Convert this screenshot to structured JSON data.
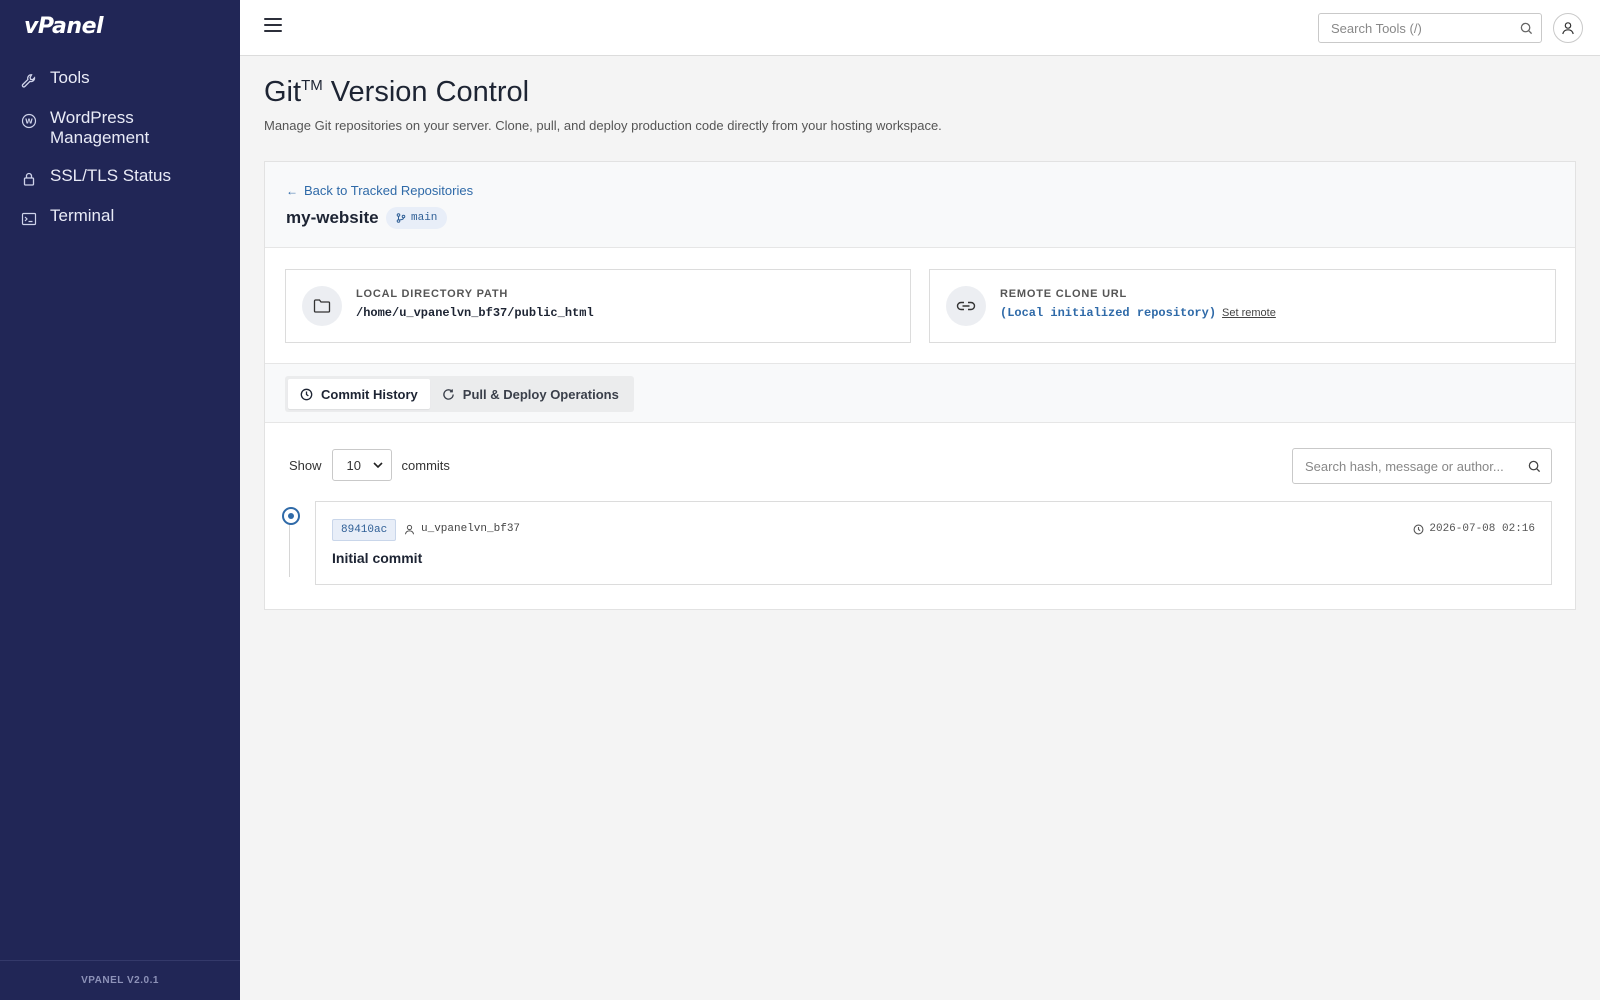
{
  "app": {
    "logo": "vPanel",
    "version": "VPANEL V2.0.1"
  },
  "sidebar": {
    "items": [
      {
        "label": "Tools",
        "icon": "wrench-icon"
      },
      {
        "label": "WordPress Management",
        "icon": "wordpress-icon"
      },
      {
        "label": "SSL/TLS Status",
        "icon": "lock-icon"
      },
      {
        "label": "Terminal",
        "icon": "terminal-icon"
      }
    ]
  },
  "topbar": {
    "search_placeholder": "Search Tools (/)"
  },
  "page": {
    "title": "Git",
    "title_mark": "TM",
    "title_rest": " Version Control",
    "description": "Manage Git repositories on your server. Clone, pull, and deploy production code directly from your hosting workspace."
  },
  "repo": {
    "back_label": "Back to Tracked Repositories",
    "name": "my-website",
    "branch": "main",
    "local": {
      "label": "LOCAL DIRECTORY PATH",
      "value": "/home/u_vpanelvn_bf37/public_html"
    },
    "remote": {
      "label": "REMOTE CLONE URL",
      "value": "(Local initialized repository)",
      "action": "Set remote"
    }
  },
  "tabs": [
    {
      "label": "Commit History",
      "active": true
    },
    {
      "label": "Pull & Deploy Operations",
      "active": false
    }
  ],
  "commits_toolbar": {
    "show_label": "Show",
    "page_size": "10",
    "unit_label": "commits",
    "search_placeholder": "Search hash, message or author..."
  },
  "commits": [
    {
      "hash": "89410ac",
      "author": "u_vpanelvn_bf37",
      "date": "2026-07-08 02:16",
      "message": "Initial commit"
    }
  ],
  "colors": {
    "sidebar_bg": "#212656",
    "accent": "#2f6aa8"
  }
}
